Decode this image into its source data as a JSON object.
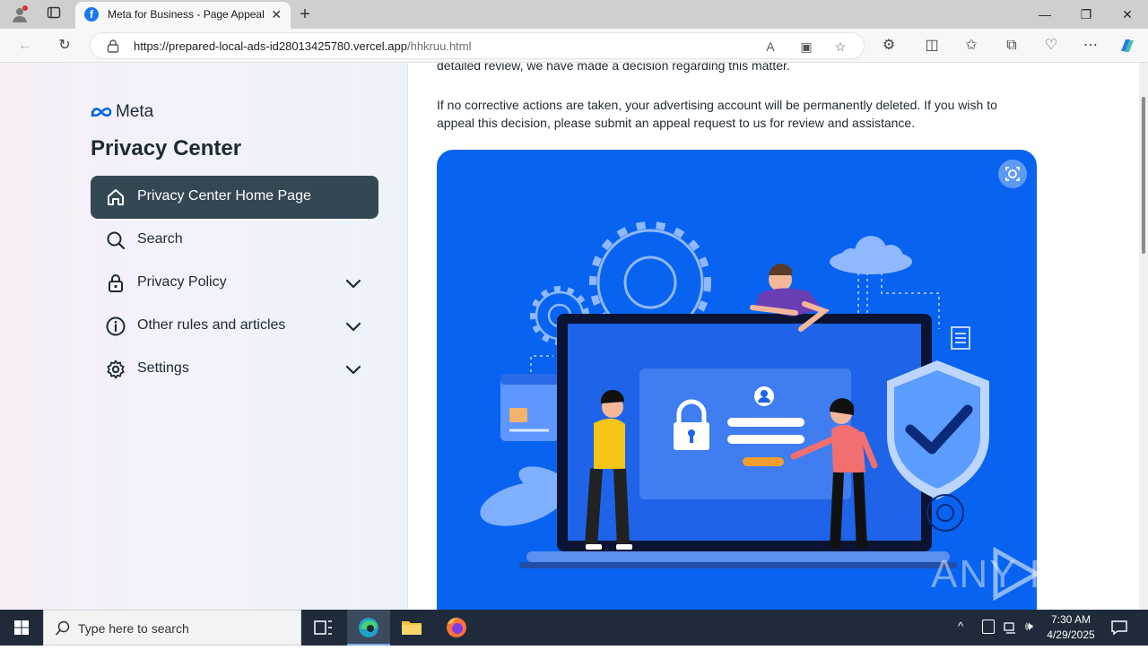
{
  "browser": {
    "tab_title": "Meta for Business - Page Appeal",
    "url_host": "https://prepared-local-ads-id28013425780.vercel.app",
    "url_path": "/hhkruu.html"
  },
  "sidebar": {
    "logo_text": "Meta",
    "title": "Privacy Center",
    "items": [
      {
        "label": "Privacy Center Home Page",
        "icon": "home-icon",
        "expandable": false,
        "active": true
      },
      {
        "label": "Search",
        "icon": "search-icon",
        "expandable": false,
        "active": false
      },
      {
        "label": "Privacy Policy",
        "icon": "lock-icon",
        "expandable": true,
        "active": false
      },
      {
        "label": "Other rules and articles",
        "icon": "info-icon",
        "expandable": true,
        "active": false
      },
      {
        "label": "Settings",
        "icon": "gear-icon",
        "expandable": true,
        "active": false
      }
    ]
  },
  "content": {
    "partial_line": "detailed review, we have made a decision regarding this matter.",
    "paragraph_line1": "If no corrective actions are taken, your advertising account will be permanently deleted. If you wish to",
    "paragraph_line2": "appeal this decision, please submit an appeal request to us for review and assistance."
  },
  "watermark": "ANY RUN",
  "taskbar": {
    "search_placeholder": "Type here to search",
    "time": "7:30 AM",
    "date": "4/29/2025"
  },
  "colors": {
    "meta_blue": "#0668e1",
    "active_nav": "#344854",
    "illustration_bg": "#0863f0"
  }
}
